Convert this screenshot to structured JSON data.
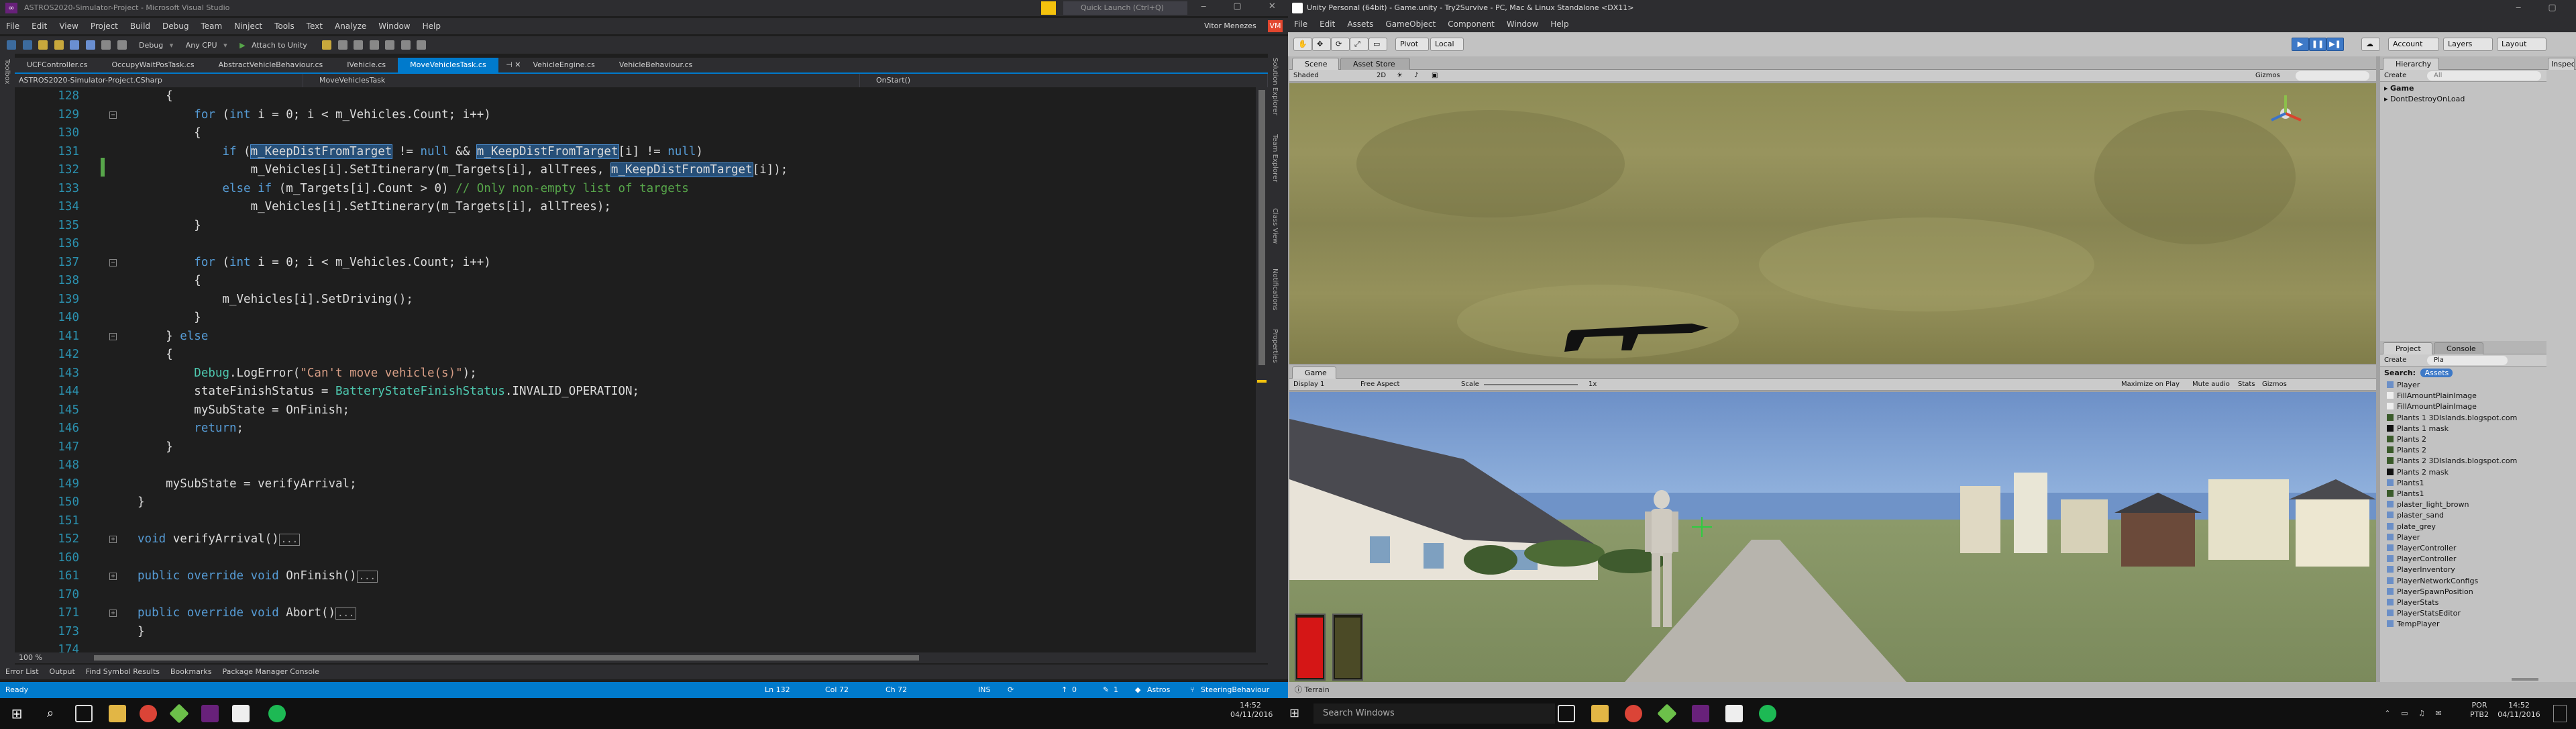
{
  "vs": {
    "window_title": "ASTROS2020-Simulator-Project - Microsoft Visual Studio",
    "quick_launch_placeholder": "Quick Launch (Ctrl+Q)",
    "user": "Vitor Menezes",
    "user_initials": "VM",
    "menu": [
      "File",
      "Edit",
      "View",
      "Project",
      "Build",
      "Debug",
      "Team",
      "Ninject",
      "Tools",
      "Text",
      "Analyze",
      "Window",
      "Help"
    ],
    "toolbar": {
      "config": "Debug",
      "platform": "Any CPU",
      "attach": "Attach to Unity"
    },
    "left_rail": [
      "Toolbox"
    ],
    "right_rail": [
      "Solution Explorer",
      "Team Explorer",
      "Class View",
      "Notifications",
      "Properties"
    ],
    "tabs": [
      "UCFController.cs",
      "OccupyWaitPosTask.cs",
      "AbstractVehicleBehaviour.cs",
      "IVehicle.cs",
      "MoveVehiclesTask.cs",
      "VehicleEngine.cs",
      "VehicleBehaviour.cs"
    ],
    "active_tab_index": 4,
    "nav": {
      "project": "ASTROS2020-Simulator-Project.CSharp",
      "class": "MoveVehiclesTask",
      "member": "OnStart()"
    },
    "code_lines": [
      {
        "n": "128",
        "t": "    {"
      },
      {
        "n": "129",
        "t": "        for (int i = 0; i < m_Vehicles.Count; i++)"
      },
      {
        "n": "130",
        "t": "        {"
      },
      {
        "n": "131",
        "t": "            if (m_KeepDistFromTarget != null && m_KeepDistFromTarget[i] != null)"
      },
      {
        "n": "132",
        "t": "                m_Vehicles[i].SetItinerary(m_Targets[i], allTrees, m_KeepDistFromTarget[i]);"
      },
      {
        "n": "133",
        "t": "            else if (m_Targets[i].Count > 0) // Only non-empty list of targets"
      },
      {
        "n": "134",
        "t": "                m_Vehicles[i].SetItinerary(m_Targets[i], allTrees);"
      },
      {
        "n": "135",
        "t": "        }"
      },
      {
        "n": "136",
        "t": ""
      },
      {
        "n": "137",
        "t": "        for (int i = 0; i < m_Vehicles.Count; i++)"
      },
      {
        "n": "138",
        "t": "        {"
      },
      {
        "n": "139",
        "t": "            m_Vehicles[i].SetDriving();"
      },
      {
        "n": "140",
        "t": "        }"
      },
      {
        "n": "141",
        "t": "    } else"
      },
      {
        "n": "142",
        "t": "    {"
      },
      {
        "n": "143",
        "t": "        Debug.LogError(\"Can't move vehicle(s)\");"
      },
      {
        "n": "144",
        "t": "        stateFinishStatus = BatteryStateFinishStatus.INVALID_OPERATION;"
      },
      {
        "n": "145",
        "t": "        mySubState = OnFinish;"
      },
      {
        "n": "146",
        "t": "        return;"
      },
      {
        "n": "147",
        "t": "    }"
      },
      {
        "n": "148",
        "t": ""
      },
      {
        "n": "149",
        "t": "    mySubState = verifyArrival;"
      },
      {
        "n": "150",
        "t": "}"
      },
      {
        "n": "151",
        "t": ""
      },
      {
        "n": "152",
        "t": "void verifyArrival()"
      },
      {
        "n": "160",
        "t": ""
      },
      {
        "n": "161",
        "t": "public override void OnFinish()"
      },
      {
        "n": "170",
        "t": ""
      },
      {
        "n": "171",
        "t": "public override void Abort()"
      },
      {
        "n": "173",
        "t": "}"
      },
      {
        "n": "174",
        "t": ""
      }
    ],
    "collapsed_marker": "...",
    "zoom": "100 %",
    "bottom_tabs": [
      "Error List",
      "Output",
      "Find Symbol Results",
      "Bookmarks",
      "Package Manager Console"
    ],
    "status": {
      "ready": "Ready",
      "ln": "Ln 132",
      "col": "Col 72",
      "ch": "Ch 72",
      "ins": "INS",
      "errors": "0",
      "warnings": "1",
      "repo": "Astros",
      "branch": "SteeringBehaviour"
    }
  },
  "unity": {
    "window_title": "Unity Personal (64bit) - Game.unity - Try2Survive - PC, Mac & Linux Standalone <DX11>",
    "menu": [
      "File",
      "Edit",
      "Assets",
      "GameObject",
      "Component",
      "Window",
      "Help"
    ],
    "toolbar": {
      "pivot": "Pivot",
      "local": "Local",
      "account": "Account",
      "layers": "Layers",
      "layout": "Layout"
    },
    "scene_tabs": [
      "Scene",
      "Asset Store"
    ],
    "scene_bar": {
      "shading": "Shaded",
      "mode": "2D",
      "gizmos": "Gizmos"
    },
    "game_tab": "Game",
    "game_bar": {
      "display": "Display 1",
      "aspect": "Free Aspect",
      "scale_label": "Scale",
      "scale": "1x",
      "maximize": "Maximize on Play",
      "mute": "Mute audio",
      "stats": "Stats",
      "gizmos": "Gizmos"
    },
    "hierarchy": {
      "tab": "Hierarchy",
      "create": "Create",
      "search_placeholder": "All",
      "items": [
        "Game",
        "DontDestroyOnLoad"
      ]
    },
    "inspector_tab": "Inspector",
    "project": {
      "tab": "Project",
      "console_tab": "Console",
      "create": "Create",
      "search_value": "Pla",
      "search_label": "Search:",
      "search_scope": "Assets",
      "items": [
        "Player",
        "FillAmountPlainImage",
        "FillAmountPlainImage",
        "Plants 1 3DIslands.blogspot.com",
        "Plants 1 mask",
        "Plants 2",
        "Plants 2",
        "Plants 2 3DIslands.blogspot.com",
        "Plants 2 mask",
        "Plants1",
        "Plants1",
        "plaster_light_brown",
        "plaster_sand",
        "plate_grey",
        "Player",
        "PlayerController",
        "PlayerController",
        "PlayerInventory",
        "PlayerNetworkConfigs",
        "PlayerSpawnPosition",
        "PlayerStats",
        "PlayerStatsEditor",
        "TempPlayer"
      ]
    },
    "bottom_status": "Terrain"
  },
  "taskbar": {
    "search_placeholder": "Search Windows",
    "lang": "POR",
    "layout": "PTB2",
    "time": "14:52",
    "date": "04/11/2016"
  },
  "colors": {
    "vs_accent": "#007acc",
    "vs_bg": "#1e1e1e",
    "unity_panel": "#c2c2c2",
    "game_sky": "#6f93c8"
  }
}
